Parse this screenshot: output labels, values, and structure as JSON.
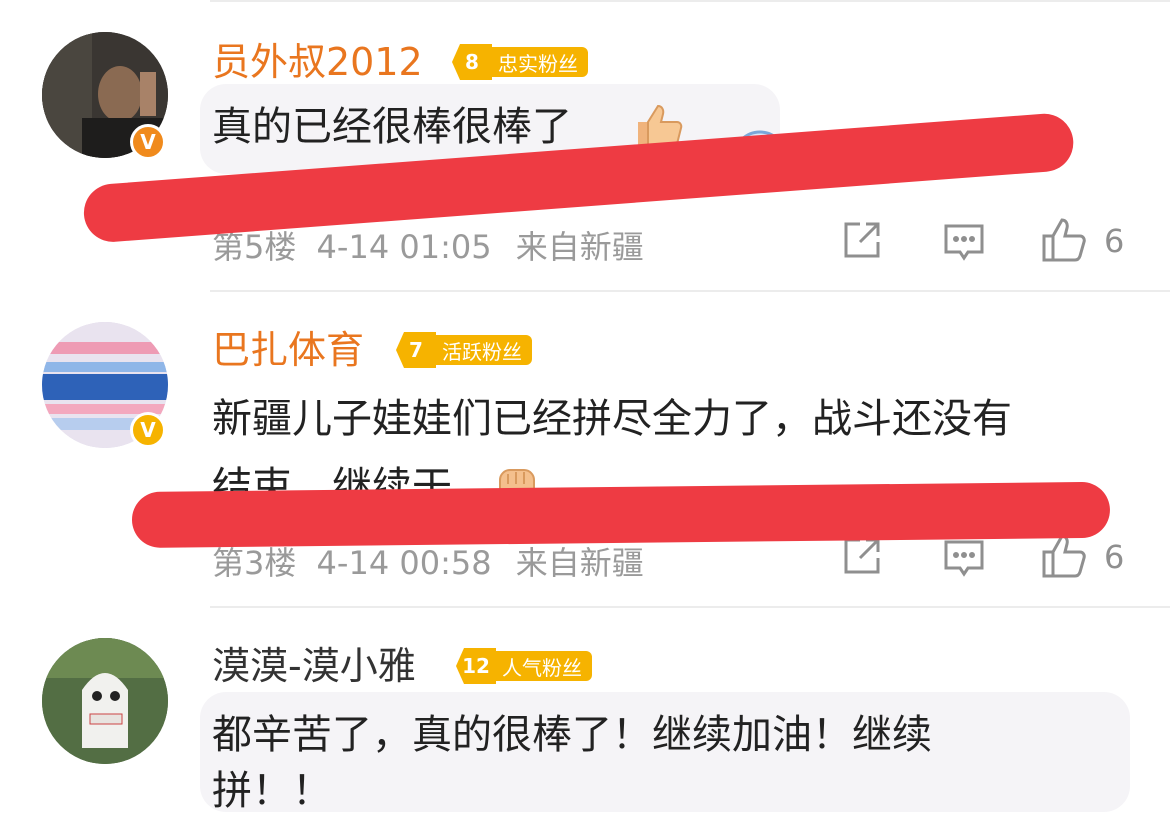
{
  "comments": [
    {
      "username": "员外叔2012",
      "fan_level": "8",
      "fan_badge": "忠实粉丝",
      "text": "真的已经很棒很棒了",
      "floor": "第5楼",
      "time": "4-14 01:05",
      "location": "来自新疆",
      "likes": "6",
      "name_color": "#e9761f"
    },
    {
      "username": "巴扎体育",
      "fan_level": "7",
      "fan_badge": "活跃粉丝",
      "text_line1": "新疆儿子娃娃们已经拼尽全力了，战斗还没有",
      "text_line2": "结束，继续干",
      "floor": "第3楼",
      "time": "4-14 00:58",
      "location": "来自新疆",
      "likes": "6",
      "name_color": "#e9761f"
    },
    {
      "username": "漠漠-漠小雅",
      "fan_level": "12",
      "fan_badge": "人气粉丝",
      "text_line1": "都辛苦了，真的很棒了！继续加油！继续",
      "text_line2": "拼！！",
      "name_color": "#333333"
    }
  ],
  "colors": {
    "accent": "#e9761f",
    "badge": "#f6b300",
    "redaction": "#ee3b43"
  },
  "icons": [
    "share-icon",
    "comment-icon",
    "like-icon",
    "thumbs-up-emoji",
    "fist-emoji",
    "verified-badge-icon"
  ]
}
